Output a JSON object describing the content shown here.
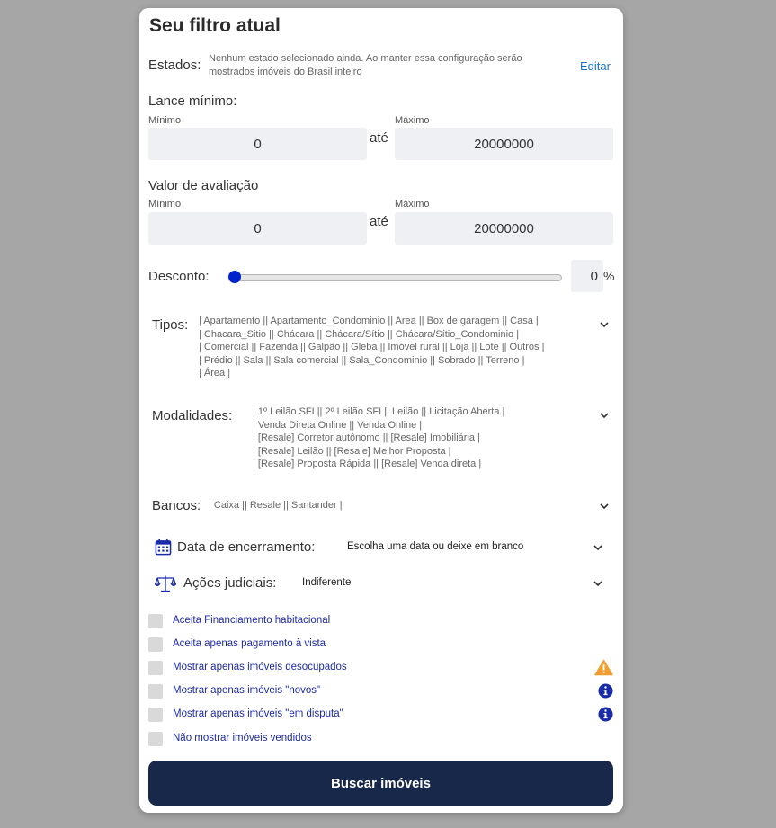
{
  "filter": {
    "title": "Seu filtro atual",
    "estados": {
      "label": "Estados:",
      "description": "Nenhum estado selecionado ainda. Ao manter essa configuração serão mostrados imóveis do Brasil inteiro",
      "edit_link": "Editar"
    },
    "lance_minimo": {
      "label": "Lance mínimo:",
      "min_label": "Mínimo",
      "max_label": "Máximo",
      "min_value": "0",
      "max_value": "20000000",
      "separator": "até"
    },
    "valor_avaliacao": {
      "label": "Valor de avaliação",
      "min_label": "Mínimo",
      "max_label": "Máximo",
      "min_value": "0",
      "max_value": "20000000",
      "separator": "até"
    },
    "desconto": {
      "label": "Desconto:",
      "value": "0",
      "unit": "%",
      "slider_fraction": 0
    },
    "tipos": {
      "label": "Tipos:",
      "lines": [
        "| Apartamento || Apartamento_Condominio || Area || Box de garagem || Casa |",
        "| Chacara_Sitio || Chácara || Chácara/Sítio || Chácara/Sítio_Condominio |",
        "| Comercial || Fazenda || Galpão || Gleba || Imóvel rural || Loja || Lote || Outros |",
        "| Prédio || Sala || Sala comercial || Sala_Condominio || Sobrado || Terreno |",
        "| Área |"
      ]
    },
    "modalidades": {
      "label": "Modalidades:",
      "lines": [
        "| 1º Leilão SFI || 2º Leilão SFI || Leilão || Licitação Aberta |",
        "| Venda Direta Online || Venda Online |",
        "| [Resale] Corretor autônomo || [Resale] Imobiliária |",
        "| [Resale] Leilão || [Resale] Melhor Proposta |",
        "| [Resale] Proposta Rápida || [Resale] Venda direta |"
      ]
    },
    "bancos": {
      "label": "Bancos:",
      "value": "| Caixa || Resale || Santander |"
    },
    "data_encerramento": {
      "label": "Data de encerramento:",
      "value": "Escolha uma data ou deixe em branco",
      "icon": "calendar-icon"
    },
    "acoes_judiciais": {
      "label": "Ações judiciais:",
      "value": "Indiferente",
      "icon": "scales-icon"
    },
    "checkboxes": [
      {
        "label": "Aceita Financiamento habitacional",
        "checked": false,
        "icon": null
      },
      {
        "label": "Aceita apenas pagamento à vista",
        "checked": false,
        "icon": null
      },
      {
        "label": "Mostrar apenas imóveis desocupados",
        "checked": false,
        "icon": "warning-icon"
      },
      {
        "label": "Mostrar apenas imóveis \"novos\"",
        "checked": false,
        "icon": "info-icon"
      },
      {
        "label": "Mostrar apenas imóveis \"em disputa\"",
        "checked": false,
        "icon": "info-icon"
      },
      {
        "label": "Não mostrar imóveis vendidos",
        "checked": false,
        "icon": null
      }
    ],
    "search_button": "Buscar imóveis"
  },
  "colors": {
    "background": "#a6a6a6",
    "card": "#ffffff",
    "button": "#17284a",
    "link": "#1e73c9",
    "checkbox_label": "#1d2aa0",
    "slider_thumb": "#0022cc",
    "warning": "#f0a030",
    "info": "#1a2ba8"
  }
}
